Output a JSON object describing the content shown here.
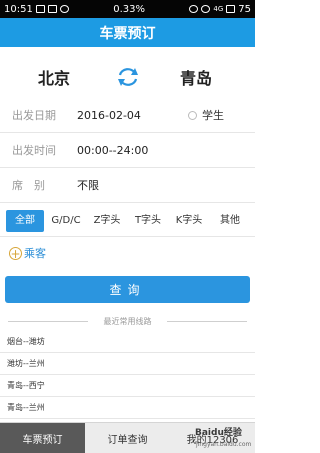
{
  "statusbar": {
    "time": "10:51",
    "percent": "0.33%",
    "network": "4G",
    "battery": "75"
  },
  "header": {
    "title": "车票预订"
  },
  "stations": {
    "from": "北京",
    "to": "青岛"
  },
  "form": {
    "date_label": "出发日期",
    "date_value": "2016-02-04",
    "student_label": "学生",
    "time_label": "出发时间",
    "time_value": "00:00--24:00",
    "seat_label": "席　别",
    "seat_value": "不限"
  },
  "train_types": [
    {
      "label": "全部",
      "active": true
    },
    {
      "label": "G/D/C",
      "active": false
    },
    {
      "label": "Z字头",
      "active": false
    },
    {
      "label": "T字头",
      "active": false
    },
    {
      "label": "K字头",
      "active": false
    },
    {
      "label": "其他",
      "active": false
    }
  ],
  "passenger": {
    "label": "乘客"
  },
  "query_button": {
    "label": "查询"
  },
  "recent": {
    "title": "最近常用线路",
    "items": [
      "烟台--潍坊",
      "潍坊--兰州",
      "青岛--西宁",
      "青岛--兰州"
    ]
  },
  "bottom_nav": [
    "车票预订",
    "订单查询",
    "我的12306"
  ],
  "watermark": {
    "brand": "Baidu经验",
    "url": "jingyan.baidu.com"
  },
  "colors": {
    "primary": "#1d9be3",
    "button": "#2b95df",
    "accent_link": "#2b8ed6",
    "plus_icon": "#d7a63a"
  }
}
